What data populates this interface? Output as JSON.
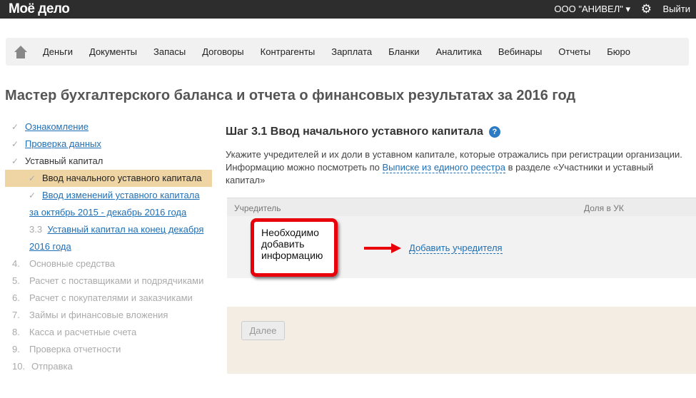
{
  "header": {
    "logo": "Моё дело",
    "org": "ООО \"АНИВЕЛ\" ▾",
    "logout": "Выйти"
  },
  "nav": [
    "Деньги",
    "Документы",
    "Запасы",
    "Договоры",
    "Контрагенты",
    "Зарплата",
    "Бланки",
    "Аналитика",
    "Вебинары",
    "Отчеты",
    "Бюро"
  ],
  "page_title": "Мастер бухгалтерского баланса и отчета о финансовых результатах за 2016 год",
  "steps": {
    "s1": "Ознакомление",
    "s2": "Проверка данных",
    "s3": "Уставный капитал",
    "s31": "Ввод начального уставного капитала",
    "s32a": "Ввод изменений уставного капитала",
    "s32b": "за октябрь 2015 - декабрь 2016 года",
    "s33num": "3.3",
    "s33a": "Уставный капитал на конец декабря",
    "s33b": "2016 года",
    "rest": [
      {
        "n": "4.",
        "t": "Основные средства"
      },
      {
        "n": "5.",
        "t": "Расчет с поставщиками и подрядчиками"
      },
      {
        "n": "6.",
        "t": "Расчет с покупателями и заказчиками"
      },
      {
        "n": "7.",
        "t": "Займы и финансовые вложения"
      },
      {
        "n": "8.",
        "t": "Касса и расчетные счета"
      },
      {
        "n": "9.",
        "t": "Проверка отчетности"
      },
      {
        "n": "10.",
        "t": "Отправка"
      }
    ]
  },
  "main": {
    "heading": "Шаг 3.1 Ввод начального уставного капитала",
    "desc1": "Укажите учредителей и их доли в уставном капитале, которые отражались при регистрации организации. Информацию можно посмотреть по ",
    "desc_link": "Выписке из единого реестра",
    "desc2": " в разделе «Участники и уставный капитал»",
    "col1": "Учредитель",
    "col2": "Доля в УК",
    "callout": "Необходимо добавить информацию",
    "add_link": "Добавить учредителя",
    "next": "Далее"
  }
}
